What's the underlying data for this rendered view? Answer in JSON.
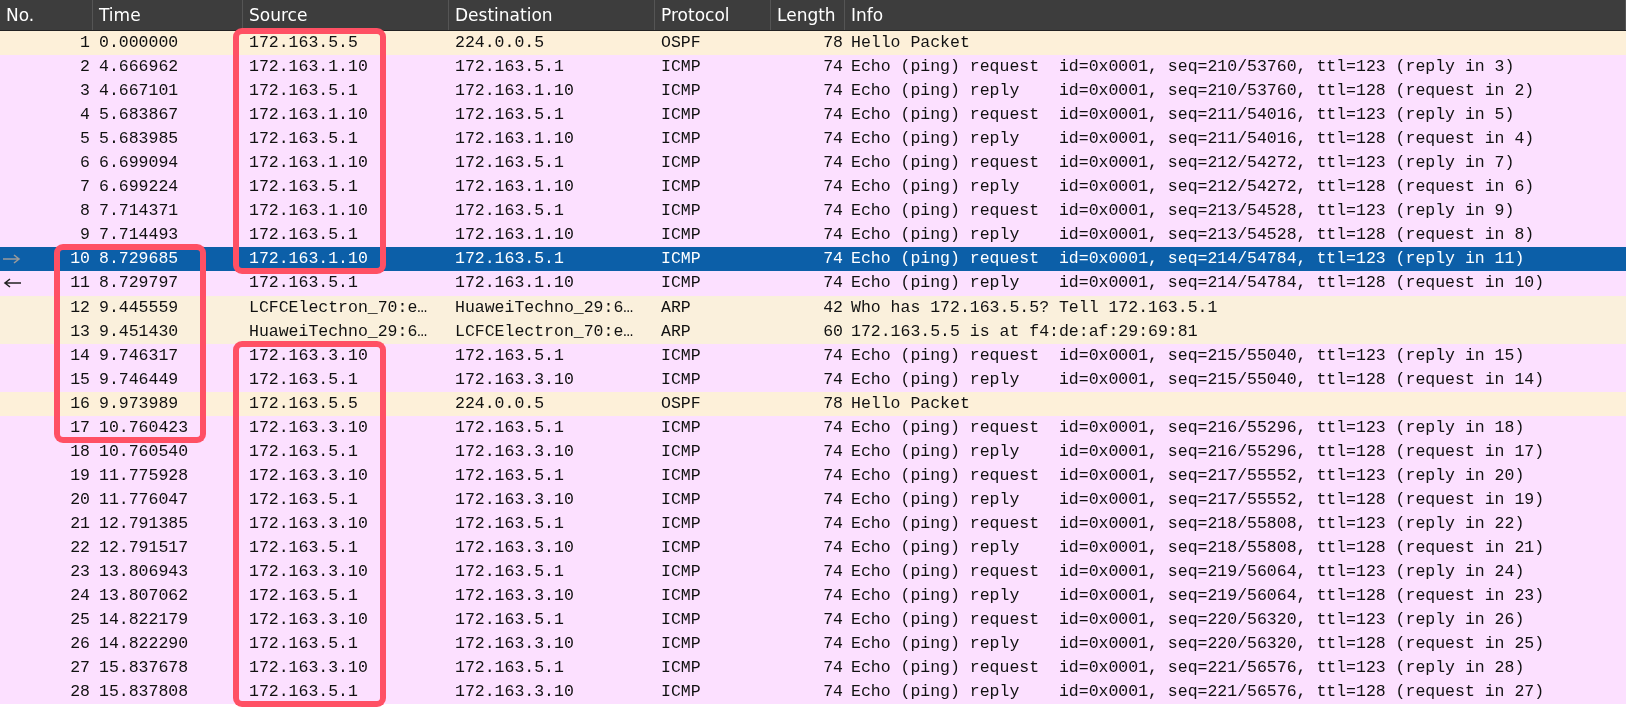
{
  "columns": [
    "No.",
    "Time",
    "Source",
    "Destination",
    "Protocol",
    "Length",
    "Info"
  ],
  "rows": [
    {
      "no": "1",
      "time": "0.000000",
      "source": "172.163.5.5",
      "destination": "224.0.0.5",
      "protocol": "OSPF",
      "length": "78",
      "info": "Hello Packet",
      "color": "#fdf0d9",
      "selected": false,
      "request_arrow": false,
      "reply_arrow": false,
      "number_boxed": false,
      "source_boxed": true
    },
    {
      "no": "2",
      "time": "4.666962",
      "source": "172.163.1.10",
      "destination": "172.163.5.1",
      "protocol": "ICMP",
      "length": "74",
      "info": "Echo (ping) request  id=0x0001, seq=210/53760, ttl=123 (reply in 3)",
      "color": "#fce0ff",
      "selected": false,
      "request_arrow": false,
      "reply_arrow": false,
      "number_boxed": false,
      "source_boxed": true
    },
    {
      "no": "3",
      "time": "4.667101",
      "source": "172.163.5.1",
      "destination": "172.163.1.10",
      "protocol": "ICMP",
      "length": "74",
      "info": "Echo (ping) reply    id=0x0001, seq=210/53760, ttl=128 (request in 2)",
      "color": "#fce0ff",
      "selected": false,
      "request_arrow": false,
      "reply_arrow": false,
      "number_boxed": false,
      "source_boxed": true
    },
    {
      "no": "4",
      "time": "5.683867",
      "source": "172.163.1.10",
      "destination": "172.163.5.1",
      "protocol": "ICMP",
      "length": "74",
      "info": "Echo (ping) request  id=0x0001, seq=211/54016, ttl=123 (reply in 5)",
      "color": "#fce0ff",
      "selected": false,
      "request_arrow": false,
      "reply_arrow": false,
      "number_boxed": false,
      "source_boxed": true
    },
    {
      "no": "5",
      "time": "5.683985",
      "source": "172.163.5.1",
      "destination": "172.163.1.10",
      "protocol": "ICMP",
      "length": "74",
      "info": "Echo (ping) reply    id=0x0001, seq=211/54016, ttl=128 (request in 4)",
      "color": "#fce0ff",
      "selected": false,
      "request_arrow": false,
      "reply_arrow": false,
      "number_boxed": false,
      "source_boxed": true
    },
    {
      "no": "6",
      "time": "6.699094",
      "source": "172.163.1.10",
      "destination": "172.163.5.1",
      "protocol": "ICMP",
      "length": "74",
      "info": "Echo (ping) request  id=0x0001, seq=212/54272, ttl=123 (reply in 7)",
      "color": "#fce0ff",
      "selected": false,
      "request_arrow": false,
      "reply_arrow": false,
      "number_boxed": false,
      "source_boxed": true
    },
    {
      "no": "7",
      "time": "6.699224",
      "source": "172.163.5.1",
      "destination": "172.163.1.10",
      "protocol": "ICMP",
      "length": "74",
      "info": "Echo (ping) reply    id=0x0001, seq=212/54272, ttl=128 (request in 6)",
      "color": "#fce0ff",
      "selected": false,
      "request_arrow": false,
      "reply_arrow": false,
      "number_boxed": false,
      "source_boxed": true
    },
    {
      "no": "8",
      "time": "7.714371",
      "source": "172.163.1.10",
      "destination": "172.163.5.1",
      "protocol": "ICMP",
      "length": "74",
      "info": "Echo (ping) request  id=0x0001, seq=213/54528, ttl=123 (reply in 9)",
      "color": "#fce0ff",
      "selected": false,
      "request_arrow": false,
      "reply_arrow": false,
      "number_boxed": false,
      "source_boxed": true
    },
    {
      "no": "9",
      "time": "7.714493",
      "source": "172.163.5.1",
      "destination": "172.163.1.10",
      "protocol": "ICMP",
      "length": "74",
      "info": "Echo (ping) reply    id=0x0001, seq=213/54528, ttl=128 (request in 8)",
      "color": "#fce0ff",
      "selected": false,
      "request_arrow": false,
      "reply_arrow": false,
      "number_boxed": false,
      "source_boxed": true
    },
    {
      "no": "10",
      "time": "8.729685",
      "source": "172.163.1.10",
      "destination": "172.163.5.1",
      "protocol": "ICMP",
      "length": "74",
      "info": "Echo (ping) request  id=0x0001, seq=214/54784, ttl=123 (reply in 11)",
      "selected": true,
      "request_arrow": true,
      "reply_arrow": false,
      "number_boxed": true,
      "source_boxed": true
    },
    {
      "no": "11",
      "time": "8.729797",
      "source": "172.163.5.1",
      "destination": "172.163.1.10",
      "protocol": "ICMP",
      "length": "74",
      "info": "Echo (ping) reply    id=0x0001, seq=214/54784, ttl=128 (request in 10)",
      "color": "#fce0ff",
      "selected": false,
      "request_arrow": false,
      "reply_arrow": true,
      "number_boxed": true,
      "source_boxed": false
    },
    {
      "no": "12",
      "time": "9.445559",
      "source": "LCFCElectron_70:e…",
      "destination": "HuaweiTechno_29:6…",
      "protocol": "ARP",
      "length": "42",
      "info": "Who has 172.163.5.5? Tell 172.163.5.1",
      "color": "#faf0dc",
      "selected": false,
      "request_arrow": false,
      "reply_arrow": false,
      "number_boxed": true,
      "source_boxed": false
    },
    {
      "no": "13",
      "time": "9.451430",
      "source": "HuaweiTechno_29:6…",
      "destination": "LCFCElectron_70:e…",
      "protocol": "ARP",
      "length": "60",
      "info": "172.163.5.5 is at f4:de:af:29:69:81",
      "color": "#faf0dc",
      "selected": false,
      "request_arrow": false,
      "reply_arrow": false,
      "number_boxed": true,
      "source_boxed": false
    },
    {
      "no": "14",
      "time": "9.746317",
      "source": "172.163.3.10",
      "destination": "172.163.5.1",
      "protocol": "ICMP",
      "length": "74",
      "info": "Echo (ping) request  id=0x0001, seq=215/55040, ttl=123 (reply in 15)",
      "color": "#fce0ff",
      "selected": false,
      "request_arrow": false,
      "reply_arrow": false,
      "number_boxed": true,
      "source_boxed": true
    },
    {
      "no": "15",
      "time": "9.746449",
      "source": "172.163.5.1",
      "destination": "172.163.3.10",
      "protocol": "ICMP",
      "length": "74",
      "info": "Echo (ping) reply    id=0x0001, seq=215/55040, ttl=128 (request in 14)",
      "color": "#fce0ff",
      "selected": false,
      "request_arrow": false,
      "reply_arrow": false,
      "number_boxed": true,
      "source_boxed": true
    },
    {
      "no": "16",
      "time": "9.973989",
      "source": "172.163.5.5",
      "destination": "224.0.0.5",
      "protocol": "OSPF",
      "length": "78",
      "info": "Hello Packet",
      "color": "#fdf0d9",
      "selected": false,
      "request_arrow": false,
      "reply_arrow": false,
      "number_boxed": true,
      "source_boxed": true
    },
    {
      "no": "17",
      "time": "10.760423",
      "source": "172.163.3.10",
      "destination": "172.163.5.1",
      "protocol": "ICMP",
      "length": "74",
      "info": "Echo (ping) request  id=0x0001, seq=216/55296, ttl=123 (reply in 18)",
      "color": "#fce0ff",
      "selected": false,
      "request_arrow": false,
      "reply_arrow": false,
      "number_boxed": true,
      "source_boxed": true
    },
    {
      "no": "18",
      "time": "10.760540",
      "source": "172.163.5.1",
      "destination": "172.163.3.10",
      "protocol": "ICMP",
      "length": "74",
      "info": "Echo (ping) reply    id=0x0001, seq=216/55296, ttl=128 (request in 17)",
      "color": "#fce0ff",
      "selected": false,
      "request_arrow": false,
      "reply_arrow": false,
      "number_boxed": false,
      "source_boxed": true
    },
    {
      "no": "19",
      "time": "11.775928",
      "source": "172.163.3.10",
      "destination": "172.163.5.1",
      "protocol": "ICMP",
      "length": "74",
      "info": "Echo (ping) request  id=0x0001, seq=217/55552, ttl=123 (reply in 20)",
      "color": "#fce0ff",
      "selected": false,
      "request_arrow": false,
      "reply_arrow": false,
      "number_boxed": false,
      "source_boxed": true
    },
    {
      "no": "20",
      "time": "11.776047",
      "source": "172.163.5.1",
      "destination": "172.163.3.10",
      "protocol": "ICMP",
      "length": "74",
      "info": "Echo (ping) reply    id=0x0001, seq=217/55552, ttl=128 (request in 19)",
      "color": "#fce0ff",
      "selected": false,
      "request_arrow": false,
      "reply_arrow": false,
      "number_boxed": false,
      "source_boxed": true
    },
    {
      "no": "21",
      "time": "12.791385",
      "source": "172.163.3.10",
      "destination": "172.163.5.1",
      "protocol": "ICMP",
      "length": "74",
      "info": "Echo (ping) request  id=0x0001, seq=218/55808, ttl=123 (reply in 22)",
      "color": "#fce0ff",
      "selected": false,
      "request_arrow": false,
      "reply_arrow": false,
      "number_boxed": false,
      "source_boxed": true
    },
    {
      "no": "22",
      "time": "12.791517",
      "source": "172.163.5.1",
      "destination": "172.163.3.10",
      "protocol": "ICMP",
      "length": "74",
      "info": "Echo (ping) reply    id=0x0001, seq=218/55808, ttl=128 (request in 21)",
      "color": "#fce0ff",
      "selected": false,
      "request_arrow": false,
      "reply_arrow": false,
      "number_boxed": false,
      "source_boxed": true
    },
    {
      "no": "23",
      "time": "13.806943",
      "source": "172.163.3.10",
      "destination": "172.163.5.1",
      "protocol": "ICMP",
      "length": "74",
      "info": "Echo (ping) request  id=0x0001, seq=219/56064, ttl=123 (reply in 24)",
      "color": "#fce0ff",
      "selected": false,
      "request_arrow": false,
      "reply_arrow": false,
      "number_boxed": false,
      "source_boxed": true
    },
    {
      "no": "24",
      "time": "13.807062",
      "source": "172.163.5.1",
      "destination": "172.163.3.10",
      "protocol": "ICMP",
      "length": "74",
      "info": "Echo (ping) reply    id=0x0001, seq=219/56064, ttl=128 (request in 23)",
      "color": "#fce0ff",
      "selected": false,
      "request_arrow": false,
      "reply_arrow": false,
      "number_boxed": false,
      "source_boxed": true
    },
    {
      "no": "25",
      "time": "14.822179",
      "source": "172.163.3.10",
      "destination": "172.163.5.1",
      "protocol": "ICMP",
      "length": "74",
      "info": "Echo (ping) request  id=0x0001, seq=220/56320, ttl=123 (reply in 26)",
      "color": "#fce0ff",
      "selected": false,
      "request_arrow": false,
      "reply_arrow": false,
      "number_boxed": false,
      "source_boxed": true
    },
    {
      "no": "26",
      "time": "14.822290",
      "source": "172.163.5.1",
      "destination": "172.163.3.10",
      "protocol": "ICMP",
      "length": "74",
      "info": "Echo (ping) reply    id=0x0001, seq=220/56320, ttl=128 (request in 25)",
      "color": "#fce0ff",
      "selected": false,
      "request_arrow": false,
      "reply_arrow": false,
      "number_boxed": false,
      "source_boxed": true
    },
    {
      "no": "27",
      "time": "15.837678",
      "source": "172.163.3.10",
      "destination": "172.163.5.1",
      "protocol": "ICMP",
      "length": "74",
      "info": "Echo (ping) request  id=0x0001, seq=221/56576, ttl=123 (reply in 28)",
      "color": "#fce0ff",
      "selected": false,
      "request_arrow": false,
      "reply_arrow": false,
      "number_boxed": false,
      "source_boxed": true
    },
    {
      "no": "28",
      "time": "15.837808",
      "source": "172.163.5.1",
      "destination": "172.163.3.10",
      "protocol": "ICMP",
      "length": "74",
      "info": "Echo (ping) reply    id=0x0001, seq=221/56576, ttl=128 (request in 27)",
      "color": "#fce0ff",
      "selected": false,
      "request_arrow": false,
      "reply_arrow": false,
      "number_boxed": false,
      "source_boxed": true
    }
  ]
}
